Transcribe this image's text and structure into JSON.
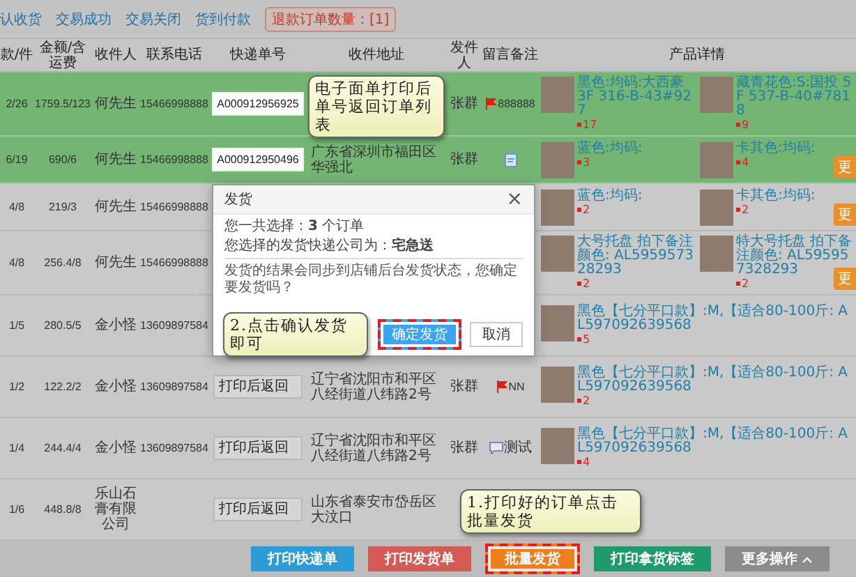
{
  "status_tabs": [
    {
      "label": "认收货",
      "selected": false
    },
    {
      "label": "交易成功",
      "selected": false
    },
    {
      "label": "交易关闭",
      "selected": false
    },
    {
      "label": "货到付款",
      "selected": false
    }
  ],
  "refund_badge": "退款订单数量：[1]",
  "columns": [
    "款/件",
    "金额/含运费",
    "收件人",
    "联系电话",
    "快递单号",
    "收件地址",
    "发件人",
    "留言备注",
    "产品详情"
  ],
  "rows": [
    {
      "selected": true,
      "count": "2/26",
      "amount": "1759.5/123",
      "recipient": "何先生",
      "phone": "15466998888",
      "tracking": "A000912956925",
      "sender": "张群",
      "note": {
        "kind": "flag",
        "text": "888888"
      },
      "products": [
        {
          "desc": "黑色:均码:大西豪 3F 316-B-43#927",
          "qty": "17"
        },
        {
          "desc": "藏青花色:S:国投 5F 537-B-40#7818",
          "qty": "9"
        }
      ]
    },
    {
      "selected": true,
      "count": "6/19",
      "amount": "690/6",
      "recipient": "何先生",
      "phone": "15466998888",
      "tracking": "A000912950496",
      "address": "广东省深圳市福田区华强北",
      "sender": "张群",
      "note": {
        "kind": "memo"
      },
      "products": [
        {
          "desc": "蓝色:均码:",
          "qty": "3"
        },
        {
          "desc": "卡其色:均码:",
          "qty": "4"
        }
      ],
      "more": "更"
    },
    {
      "selected": false,
      "count": "4/8",
      "amount": "219/3",
      "recipient": "何先生",
      "phone": "15466998888",
      "products": [
        {
          "desc": "蓝色:均码:",
          "qty": "2"
        },
        {
          "desc": "卡其色:均码:",
          "qty": "2"
        }
      ],
      "more": "更"
    },
    {
      "selected": false,
      "count": "4/8",
      "amount": "256.4/8",
      "recipient": "何先生",
      "phone": "15466998888",
      "products": [
        {
          "desc": "大号托盘 拍下备注颜色: AL595957328293",
          "qty": "2"
        },
        {
          "desc": "特大号托盘 拍下备注颜色: AL595957328293",
          "qty": "2"
        }
      ],
      "more": "更"
    },
    {
      "selected": false,
      "count": "1/5",
      "amount": "280.5/5",
      "recipient": "金小怪",
      "phone": "13609897584",
      "products": [
        {
          "desc": "黑色【七分平口款】:M,【适合80-100斤: AL597092639568",
          "qty": "5"
        }
      ]
    },
    {
      "selected": false,
      "count": "1/2",
      "amount": "122.2/2",
      "recipient": "金小怪",
      "phone": "13609897584",
      "tracking": "打印后返回",
      "address": "辽宁省沈阳市和平区八经街道八纬路2号",
      "sender": "张群",
      "note": {
        "kind": "flag",
        "text": "NN"
      },
      "products": [
        {
          "desc": "黑色【七分平口款】:M,【适合80-100斤: AL597092639568",
          "qty": "2"
        }
      ]
    },
    {
      "selected": false,
      "count": "1/4",
      "amount": "244.4/4",
      "recipient": "金小怪",
      "phone": "13609897584",
      "tracking": "打印后返回",
      "address": "辽宁省沈阳市和平区八经街道八纬路2号",
      "sender": "张群",
      "note": {
        "kind": "comment",
        "text": "测试"
      },
      "products": [
        {
          "desc": "黑色【七分平口款】:M,【适合80-100斤: AL597092639568",
          "qty": "4"
        }
      ]
    },
    {
      "selected": false,
      "count": "1/6",
      "amount": "448.8/8",
      "recipient": "乐山石膏有限公司",
      "tracking": "打印后返回",
      "address": "山东省泰安市岱岳区大汶口",
      "products": []
    }
  ],
  "dialog": {
    "title": "发货",
    "close": "×",
    "lines": [
      "您一共选择：**3** 个订单",
      "您选择的发货快递公司为：**宅急送**"
    ],
    "message": "发货的结果会同步到店铺后台发货状态，您确定要发货吗？",
    "buttons": [
      {
        "label": "确定发货",
        "kind": "primary",
        "highlighted": true
      },
      {
        "label": "取消",
        "kind": "plain",
        "highlighted": false
      }
    ]
  },
  "callouts": [
    {
      "kind": "top",
      "text": "电子面单打印后单号返回订单列表"
    },
    {
      "kind": "dialog",
      "text": "2.点击确认发货即可"
    },
    {
      "kind": "bottom",
      "text": "1.打印好的订单点击批量发货"
    }
  ],
  "actions": [
    {
      "label": "打印快递单",
      "kind": "blue",
      "highlighted": false
    },
    {
      "label": "打印发货单",
      "kind": "red",
      "highlighted": false
    },
    {
      "label": "批量发货",
      "kind": "orange",
      "highlighted": true
    },
    {
      "label": "打印拿货标签",
      "kind": "green",
      "highlighted": false
    },
    {
      "label": "更多操作",
      "kind": "gray",
      "highlighted": false,
      "caret": true
    }
  ]
}
